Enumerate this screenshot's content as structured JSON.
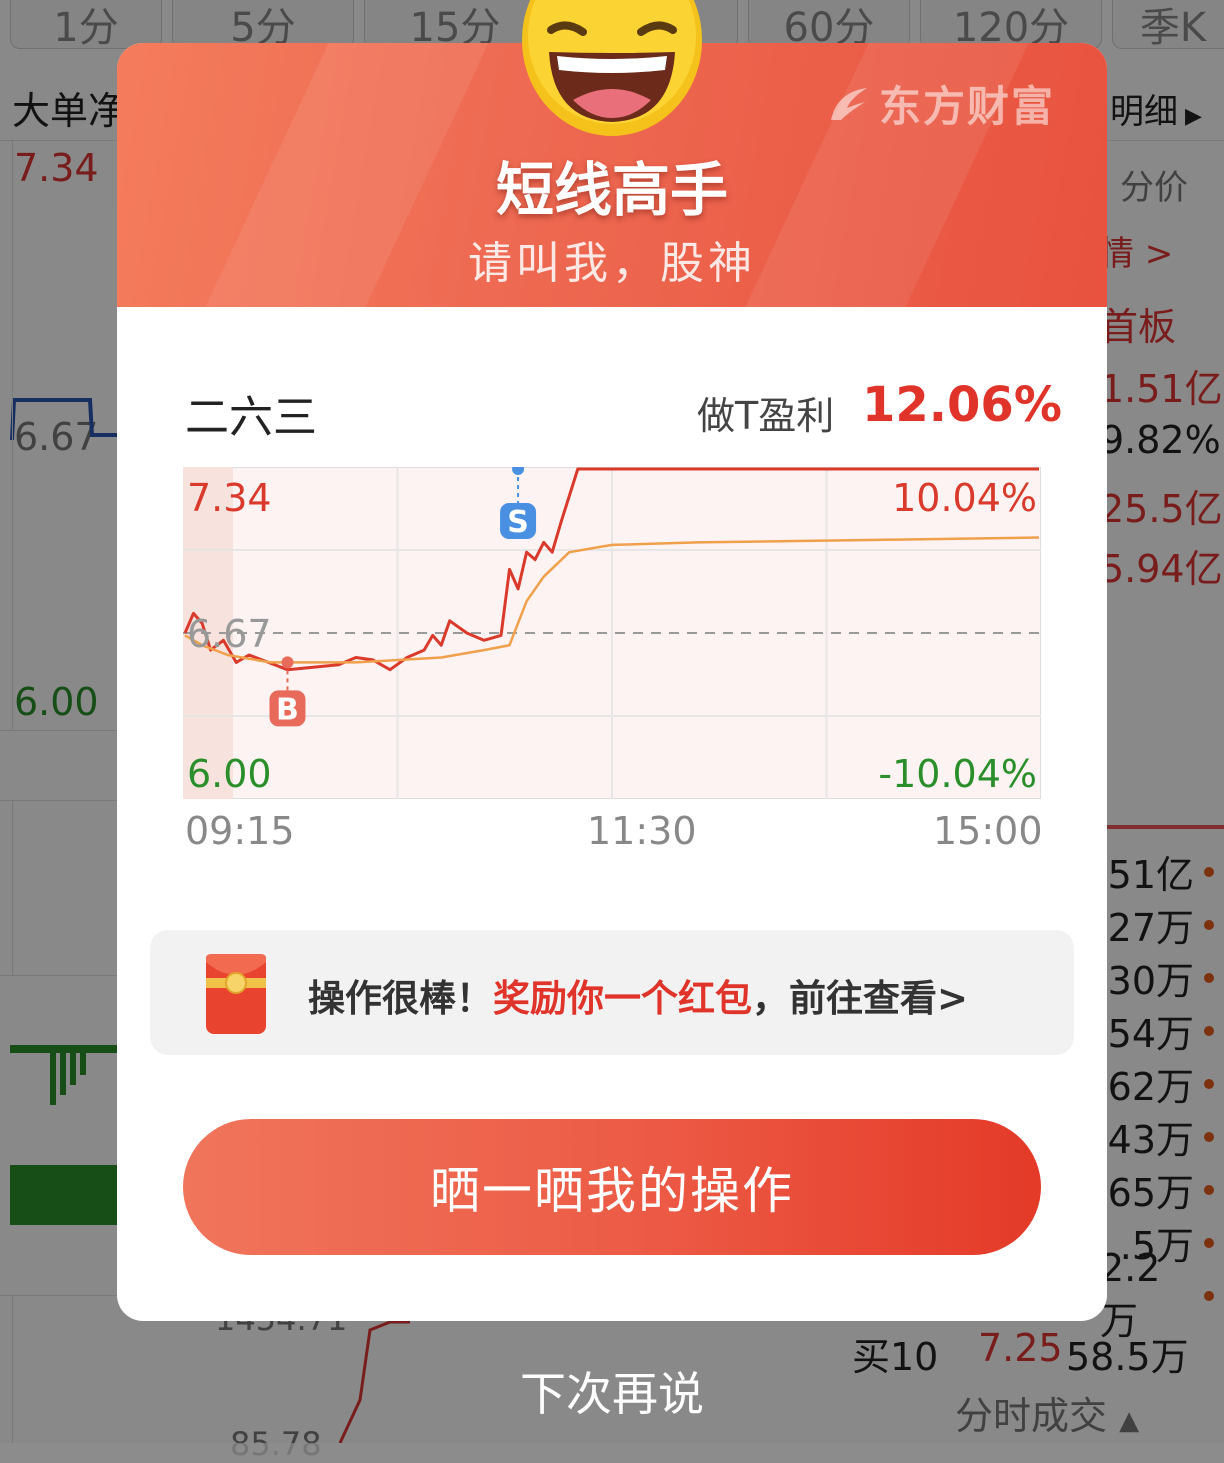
{
  "background": {
    "tabs": [
      "1分",
      "5分",
      "15分",
      "60分",
      "120分",
      "季K"
    ],
    "left_label": "大单净",
    "detail_label": "明细",
    "price_high": "7.34",
    "price_mid": "6.67",
    "price_low": "6.00",
    "right_header": "分价",
    "right_link": "情 >",
    "right_board": "首板",
    "right_values": [
      "1.51亿",
      "9.82%",
      "25.5亿",
      "5.94亿"
    ],
    "right_list": [
      "51亿",
      "27万",
      "30万",
      "54万",
      "62万",
      "43万",
      "65万",
      ".5万",
      "2.2万"
    ],
    "buy10_label": "买10",
    "buy10_price": "7.25",
    "buy10_volume": "58.5万",
    "bottom_tab": "分时成交",
    "bottom_tab_arrow": "▲",
    "chart_partial_value": "1454.71",
    "chart_partial_value_2": "85.78"
  },
  "modal": {
    "brand": "东方财富",
    "title": "短线高手",
    "subtitle": "请叫我，股神",
    "stock_name": "二六三",
    "profit_label": "做T盈利",
    "profit_value": "12.06%",
    "reward_prefix": "操作很棒！",
    "reward_highlight": "奖励你一个红包",
    "reward_suffix": "，前往查看>",
    "cta_label": "晒一晒我的操作",
    "dismiss_label": "下次再说",
    "accent_color": "#e0332a"
  },
  "chart_data": {
    "type": "line",
    "x": [
      "09:15",
      "11:30",
      "15:00"
    ],
    "y_left_ticks": [
      "7.34",
      "6.67",
      "6.00"
    ],
    "y_right_ticks": [
      "10.04%",
      "-10.04%"
    ],
    "ylim": [
      6.0,
      7.34
    ],
    "prev_close": 6.67,
    "series": [
      {
        "role": "price",
        "color": "#d93a2b",
        "points": [
          [
            0.0,
            6.67
          ],
          [
            0.01,
            6.75
          ],
          [
            0.02,
            6.71
          ],
          [
            0.03,
            6.6
          ],
          [
            0.045,
            6.64
          ],
          [
            0.06,
            6.55
          ],
          [
            0.075,
            6.58
          ],
          [
            0.09,
            6.56
          ],
          [
            0.12,
            6.52
          ],
          [
            0.15,
            6.53
          ],
          [
            0.18,
            6.54
          ],
          [
            0.2,
            6.57
          ],
          [
            0.22,
            6.56
          ],
          [
            0.24,
            6.52
          ],
          [
            0.26,
            6.57
          ],
          [
            0.28,
            6.6
          ],
          [
            0.29,
            6.66
          ],
          [
            0.3,
            6.62
          ],
          [
            0.31,
            6.72
          ],
          [
            0.33,
            6.67
          ],
          [
            0.35,
            6.64
          ],
          [
            0.36,
            6.65
          ],
          [
            0.37,
            6.66
          ],
          [
            0.38,
            6.93
          ],
          [
            0.39,
            6.85
          ],
          [
            0.4,
            7.0
          ],
          [
            0.41,
            6.97
          ],
          [
            0.42,
            7.04
          ],
          [
            0.43,
            7.0
          ],
          [
            0.44,
            7.12
          ],
          [
            0.46,
            7.34
          ],
          [
            1.0,
            7.34
          ]
        ]
      },
      {
        "role": "average",
        "color": "#f0a04b",
        "points": [
          [
            0.0,
            6.66
          ],
          [
            0.02,
            6.62
          ],
          [
            0.05,
            6.58
          ],
          [
            0.1,
            6.55
          ],
          [
            0.2,
            6.55
          ],
          [
            0.3,
            6.57
          ],
          [
            0.35,
            6.6
          ],
          [
            0.38,
            6.62
          ],
          [
            0.4,
            6.8
          ],
          [
            0.42,
            6.9
          ],
          [
            0.45,
            7.0
          ],
          [
            0.5,
            7.03
          ],
          [
            0.6,
            7.04
          ],
          [
            0.8,
            7.05
          ],
          [
            1.0,
            7.06
          ]
        ]
      }
    ],
    "markers": [
      {
        "label": "B",
        "x": 0.12,
        "y": 6.55,
        "color": "#e86a5a"
      },
      {
        "label": "S",
        "x": 0.39,
        "y": 7.34,
        "color": "#4a90e2"
      }
    ]
  }
}
